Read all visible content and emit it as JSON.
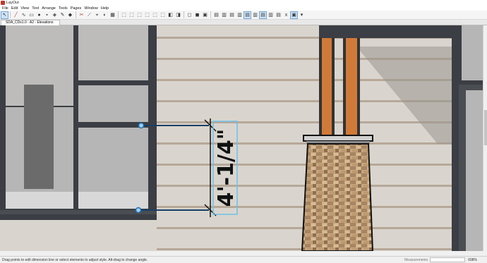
{
  "window": {
    "title": "LayOut"
  },
  "menu": [
    "File",
    "Edit",
    "View",
    "Text",
    "Arrange",
    "Tools",
    "Pages",
    "Window",
    "Help"
  ],
  "toolbar": {
    "tools": [
      {
        "icon": "select-arrow-icon",
        "active": true
      },
      {
        "icon": "line-tool-icon"
      },
      {
        "icon": "freehand-tool-icon"
      },
      {
        "icon": "rectangle-tool-icon"
      },
      {
        "icon": "circle-tool-icon"
      },
      {
        "icon": "text-tool-icon"
      },
      {
        "icon": "eraser-icon"
      },
      {
        "icon": "eyedropper-icon"
      },
      {
        "icon": "paint-bucket-icon"
      },
      {
        "icon": "split-icon"
      },
      {
        "icon": "join-icon"
      },
      {
        "icon": "dimension-tool-icon"
      },
      {
        "icon": "label-tool-icon"
      },
      {
        "icon": "scrapbook-icon"
      },
      {
        "icon": "front-view-icon"
      },
      {
        "icon": "back-view-icon"
      },
      {
        "icon": "left-view-icon"
      },
      {
        "icon": "right-view-icon"
      },
      {
        "icon": "top-view-icon"
      },
      {
        "icon": "iso-view-icon"
      },
      {
        "icon": "camera-icon"
      },
      {
        "icon": "perspective-icon"
      },
      {
        "icon": "group-icon"
      },
      {
        "icon": "ungroup-icon"
      },
      {
        "icon": "lock-icon"
      },
      {
        "icon": "align-left-icon"
      },
      {
        "icon": "align-center-icon",
        "active": true
      },
      {
        "icon": "align-right-icon"
      },
      {
        "icon": "align-top-icon"
      },
      {
        "icon": "align-middle-icon",
        "active": true
      },
      {
        "icon": "align-bottom-icon"
      },
      {
        "icon": "clear-format-icon"
      },
      {
        "icon": "grid-snap-icon",
        "active": true
      },
      {
        "icon": "more-icon"
      }
    ]
  },
  "document_tab": {
    "label": "SDA_CDs1.0 - A2 - Elevations"
  },
  "canvas": {
    "dimension_label": "4'-1/4\""
  },
  "statusbar": {
    "hint": "Drag points to edit dimension line or select elements to adjust style. Alt-drag to change angle.",
    "measurements_label": "Measurements",
    "zoom": "698%"
  },
  "colors": {
    "siding": "#d9d5ce",
    "siding_line": "#b7a898",
    "window_frame": "#3b3e44",
    "glass": "#b6b6b6",
    "post_orange": "#d07a3a",
    "dimension_blue": "#1f6fb4",
    "selection_box": "#6ec0e8"
  }
}
